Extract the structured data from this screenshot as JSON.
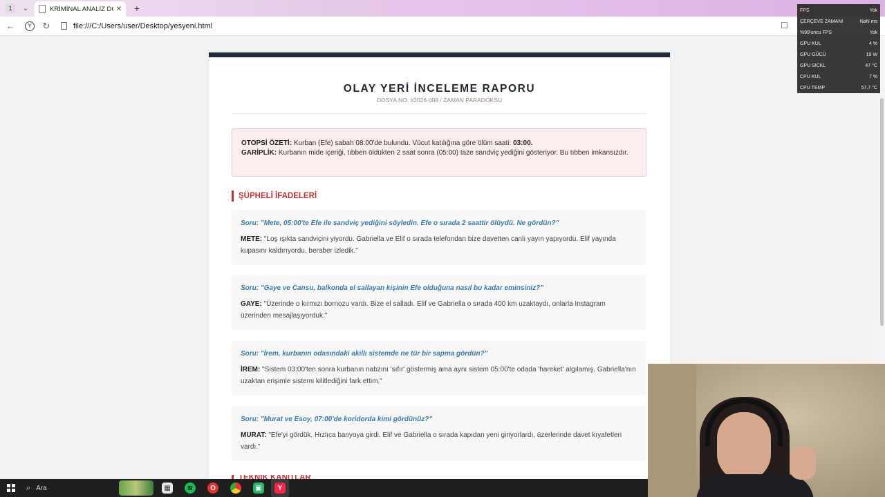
{
  "browser": {
    "tab_count": "1",
    "tab_title": "KRİMİNAL ANALİZ DOSYA",
    "url": "file:///C:/Users/user/Desktop/yesyeni.html"
  },
  "report": {
    "title": "OLAY YERİ İNCELEME RAPORU",
    "subtitle": "DOSYA NO: #2026-009 / ZAMAN PARADOKSU",
    "autopsy_label": "OTOPSİ ÖZETİ:",
    "autopsy_text": " Kurban (Efe) sabah 08:00'de bulundu. Vücut katılığına göre ölüm saati: ",
    "autopsy_time": "03:00.",
    "oddity_label": "GARİPLİK:",
    "oddity_text": " Kurbanın mide içeriği, tıbben öldükten 2 saat sonra (05:00) taze sandviç yediğini gösteriyor. Bu tıbben imkansızdır.",
    "section_title": "ŞÜPHELİ İFADELERİ",
    "next_section": "TEKNİK KANITLAR",
    "statements": [
      {
        "question": "Soru: \"Mete, 05:00'te Efe ile sandviç yediğini söyledin. Efe o sırada 2 saattir ölüydü. Ne gördün?\"",
        "speaker": "METE:",
        "answer": " \"Loş ışıkta sandviçini yiyordu. Gabriella ve Elif o sırada telefondan bize davetten canlı yayın yapıyordu. Elif yayında kupasını kaldırıyordu, beraber izledik.\""
      },
      {
        "question": "Soru: \"Gaye ve Cansu, balkonda el sallayan kişinin Efe olduğuna nasıl bu kadar eminsiniz?\"",
        "speaker": "GAYE:",
        "answer": " \"Üzerinde o kırmızı bornozu vardı. Bize el salladı. Elif ve Gabriella o sırada 400 km uzaktaydı, onlarla Instagram üzerinden mesajlaşıyorduk.\""
      },
      {
        "question": "Soru: \"İrem, kurbanın odasındaki akıllı sistemde ne tür bir sapma gördün?\"",
        "speaker": "İREM:",
        "answer": " \"Sistem 03:00'ten sonra kurbanın nabzını 'sıfır' göstermiş ama aynı sistem 05:00'te odada 'hareket' algılamış. Gabriella'nın uzaktan erişimle sistemi kilitlediğini fark ettim.\""
      },
      {
        "question": "Soru: \"Murat ve Esoy, 07:00'de koridorda kimi gördünüz?\"",
        "speaker": "MURAT:",
        "answer": " \"Efe'yi gördük. Hızlıca banyoya girdi. Elif ve Gabriella o sırada kapıdan yeni giriyorlardı, üzerlerinde davet kıyafetleri vardı.\""
      }
    ]
  },
  "perf_overlay": [
    {
      "label": "FPS",
      "value": "Yok"
    },
    {
      "label": "ÇERÇEVE ZAMANI",
      "value": "NaN ms"
    },
    {
      "label": "%99'uncu FPS",
      "value": "Yok"
    },
    {
      "label": "GPU KUL",
      "value": "4 %"
    },
    {
      "label": "GPU GÜCÜ",
      "value": "19 W"
    },
    {
      "label": "GPU SICKL",
      "value": "47 °C"
    },
    {
      "label": "CPU KUL",
      "value": "7 %"
    },
    {
      "label": "CPU TEMP",
      "value": "57.7 °C"
    }
  ],
  "taskbar": {
    "search_label": "Ara"
  },
  "colors": {
    "accent_red": "#b83535",
    "question_blue": "#3c7aa6",
    "header_bar": "#1f2b3a"
  }
}
